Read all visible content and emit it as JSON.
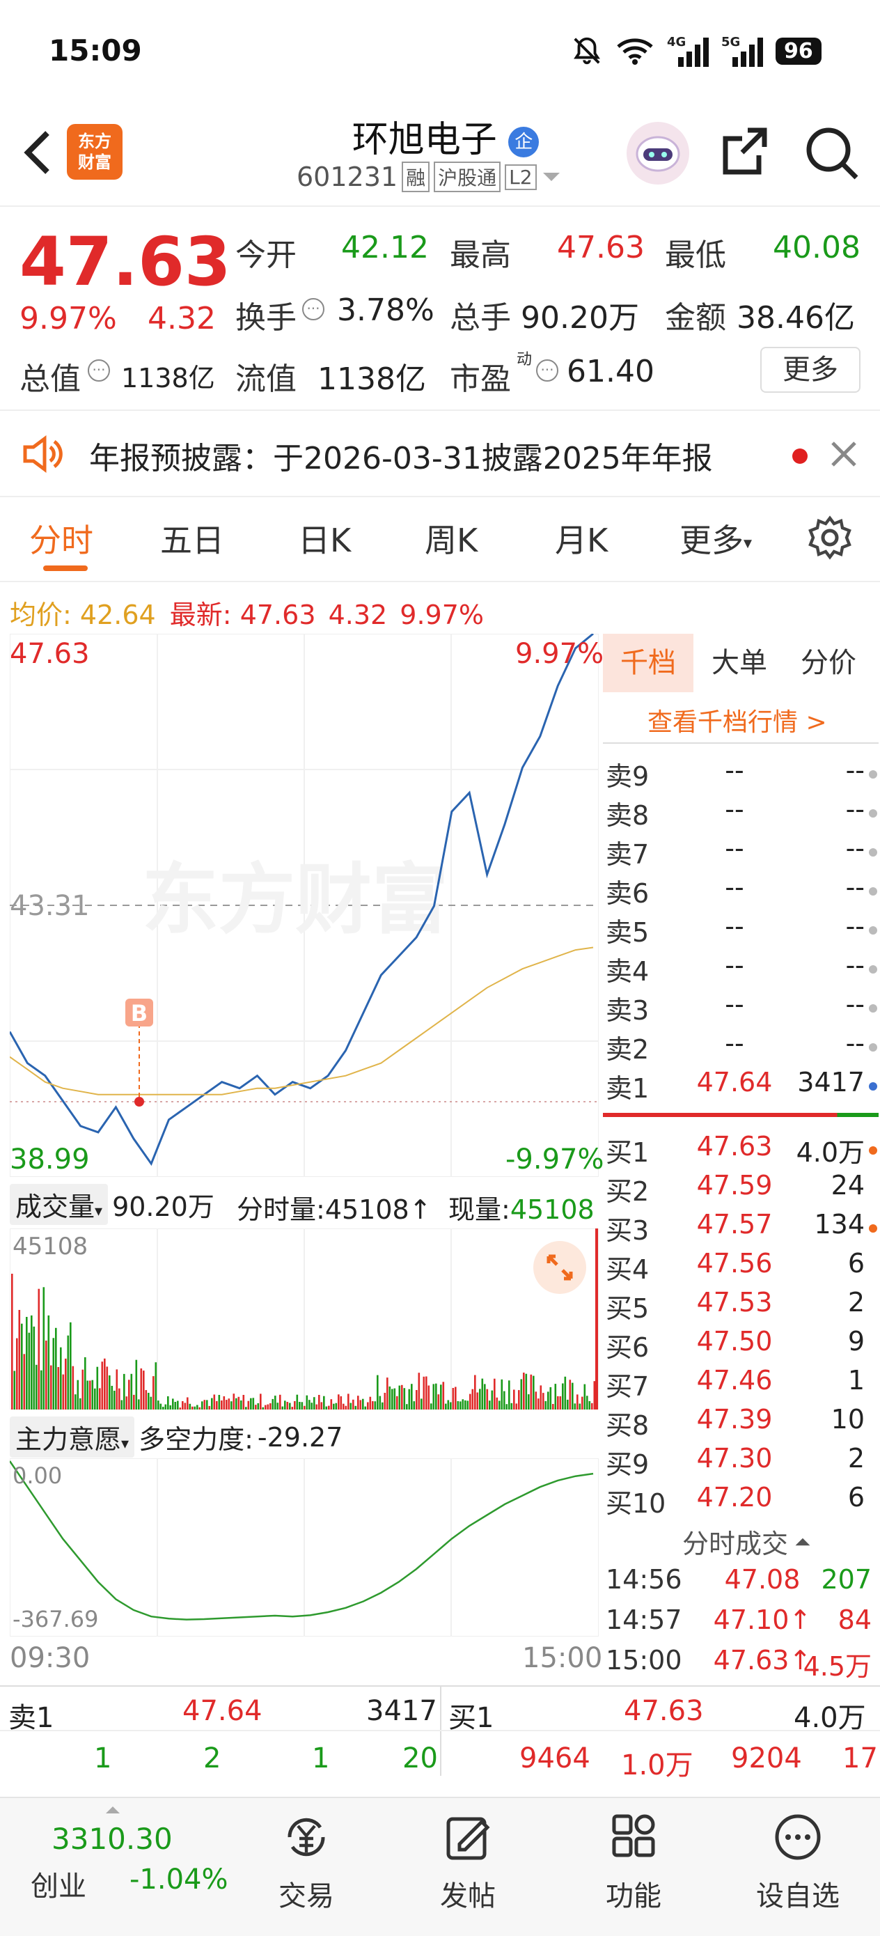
{
  "status_bar": {
    "time": "15:09",
    "battery": "96",
    "net1": "4G",
    "net2": "5G"
  },
  "header": {
    "title": "环旭电子",
    "title_badge": "企",
    "code": "601231",
    "tags": [
      "融",
      "沪股通",
      "L2"
    ]
  },
  "quote": {
    "price": "47.63",
    "change_pct": "9.97%",
    "change": "4.32",
    "open_label": "今开",
    "open": "42.12",
    "high_label": "最高",
    "high": "47.63",
    "low_label": "最低",
    "low": "40.08",
    "turnover_label": "换手",
    "turnover": "3.78%",
    "volume_label": "总手",
    "volume": "90.20万",
    "amount_label": "金额",
    "amount": "38.46亿",
    "mktcap_label": "总值",
    "mktcap": "1138亿",
    "float_label": "流值",
    "float_cap": "1138亿",
    "pe_label": "市盈",
    "pe_sup": "动",
    "pe": "61.40",
    "more_button": "更多"
  },
  "notice": {
    "text": "年报预披露：于2026-03-31披露2025年年报"
  },
  "tabs": [
    "分时",
    "五日",
    "日K",
    "周K",
    "月K",
    "更多"
  ],
  "active_tab": "分时",
  "info_line": {
    "avg_label": "均价:",
    "avg": "42.64",
    "last_label": "最新:",
    "last": "47.63",
    "chg": "4.32",
    "pct": "9.97%"
  },
  "chart_labels": {
    "top_price": "47.63",
    "top_pct": "9.97%",
    "mid_price": "43.31",
    "bottom_price": "38.99",
    "bottom_pct": "-9.97%",
    "watermark": "东方财富",
    "b_marker": "B"
  },
  "volume_bar": {
    "dropdown": "成交量",
    "total": "90.20万",
    "minute_label": "分时量:",
    "minute_val": "45108↑",
    "current_label": "现量:",
    "current_val": "45108",
    "axis_max": "45108"
  },
  "indicator_bar": {
    "dropdown": "主力意愿",
    "label": "多空力度:",
    "value": "-29.27",
    "top": "0.00",
    "bottom": "-367.69"
  },
  "time_axis": {
    "start": "09:30",
    "end": "15:00"
  },
  "order_book": {
    "tabs": [
      "千档",
      "大单",
      "分价"
    ],
    "link": "查看千档行情 >",
    "sells": [
      {
        "label": "卖9",
        "price": "--",
        "vol": "--"
      },
      {
        "label": "卖8",
        "price": "--",
        "vol": "--"
      },
      {
        "label": "卖7",
        "price": "--",
        "vol": "--"
      },
      {
        "label": "卖6",
        "price": "--",
        "vol": "--"
      },
      {
        "label": "卖5",
        "price": "--",
        "vol": "--"
      },
      {
        "label": "卖4",
        "price": "--",
        "vol": "--"
      },
      {
        "label": "卖3",
        "price": "--",
        "vol": "--"
      },
      {
        "label": "卖2",
        "price": "--",
        "vol": "--"
      },
      {
        "label": "卖1",
        "price": "47.64",
        "vol": "3417"
      }
    ],
    "buys": [
      {
        "label": "买1",
        "price": "47.63",
        "vol": "4.0万"
      },
      {
        "label": "买2",
        "price": "47.59",
        "vol": "24"
      },
      {
        "label": "买3",
        "price": "47.57",
        "vol": "134"
      },
      {
        "label": "买4",
        "price": "47.56",
        "vol": "6"
      },
      {
        "label": "买5",
        "price": "47.53",
        "vol": "2"
      },
      {
        "label": "买6",
        "price": "47.50",
        "vol": "9"
      },
      {
        "label": "买7",
        "price": "47.46",
        "vol": "1"
      },
      {
        "label": "买8",
        "price": "47.39",
        "vol": "10"
      },
      {
        "label": "买9",
        "price": "47.30",
        "vol": "2"
      },
      {
        "label": "买10",
        "price": "47.20",
        "vol": "6"
      }
    ],
    "trades_title": "分时成交",
    "trades": [
      {
        "time": "14:56",
        "price": "47.08",
        "vol": "207"
      },
      {
        "time": "14:57",
        "price": "47.10↑",
        "vol": "84"
      },
      {
        "time": "15:00",
        "price": "47.63↑",
        "vol": "4.5万"
      }
    ]
  },
  "bottom_book": {
    "sell_label": "卖1",
    "sell_price": "47.64",
    "sell_vol": "3417",
    "buy_label": "买1",
    "buy_price": "47.63",
    "buy_vol": "4.0万",
    "sell_queue": [
      "1",
      "2",
      "1",
      "20"
    ],
    "buy_queue": [
      "9464",
      "1.0万",
      "9204",
      "17"
    ]
  },
  "bottom_nav": {
    "index_value": "3310.30",
    "index_name": "创业",
    "index_pct": "-1.04%",
    "items": [
      "交易",
      "发帖",
      "功能",
      "设自选"
    ]
  },
  "colors": {
    "up": "#e02a2a",
    "down": "#1a9a1a",
    "accent": "#f06a1d",
    "line": "#2a64b0",
    "avg_line": "#e0b44a"
  },
  "chart_data": [
    {
      "type": "line",
      "title": "",
      "x": [
        "09:30",
        "15:00"
      ],
      "series": [
        {
          "name": "",
          "values": [
            41.3,
            40.8,
            40.6,
            40.2,
            39.8,
            39.7,
            40.1,
            39.6,
            39.2,
            39.9,
            40.1,
            40.3,
            40.5,
            40.4,
            40.6,
            40.3,
            40.5,
            40.4,
            40.6,
            41.0,
            41.6,
            42.2,
            42.5,
            42.8,
            43.3,
            44.8,
            45.1,
            43.8,
            44.6,
            45.5,
            46.0,
            46.8,
            47.4,
            47.63
          ]
        },
        {
          "name": "",
          "values": [
            40.9,
            40.7,
            40.5,
            40.4,
            40.35,
            40.3,
            40.3,
            40.3,
            40.3,
            40.3,
            40.3,
            40.3,
            40.3,
            40.35,
            40.4,
            40.4,
            40.45,
            40.5,
            40.55,
            40.6,
            40.7,
            40.8,
            41.0,
            41.2,
            41.4,
            41.6,
            41.8,
            42.0,
            42.15,
            42.3,
            42.4,
            42.5,
            42.6,
            42.64
          ]
        }
      ],
      "ylim": [
        38.99,
        47.63
      ]
    },
    {
      "type": "line",
      "title": "",
      "x": [
        "09:30",
        "15:00"
      ],
      "series": [
        {
          "name": "",
          "values": [
            0,
            -60,
            -120,
            -180,
            -230,
            -280,
            -320,
            -345,
            -360,
            -365,
            -367,
            -366,
            -364,
            -362,
            -360,
            -358,
            -360,
            -357,
            -350,
            -340,
            -325,
            -305,
            -280,
            -250,
            -215,
            -180,
            -150,
            -125,
            -100,
            -80,
            -60,
            -45,
            -35,
            -29.27
          ]
        }
      ],
      "ylim": [
        -367.69,
        0
      ]
    }
  ]
}
